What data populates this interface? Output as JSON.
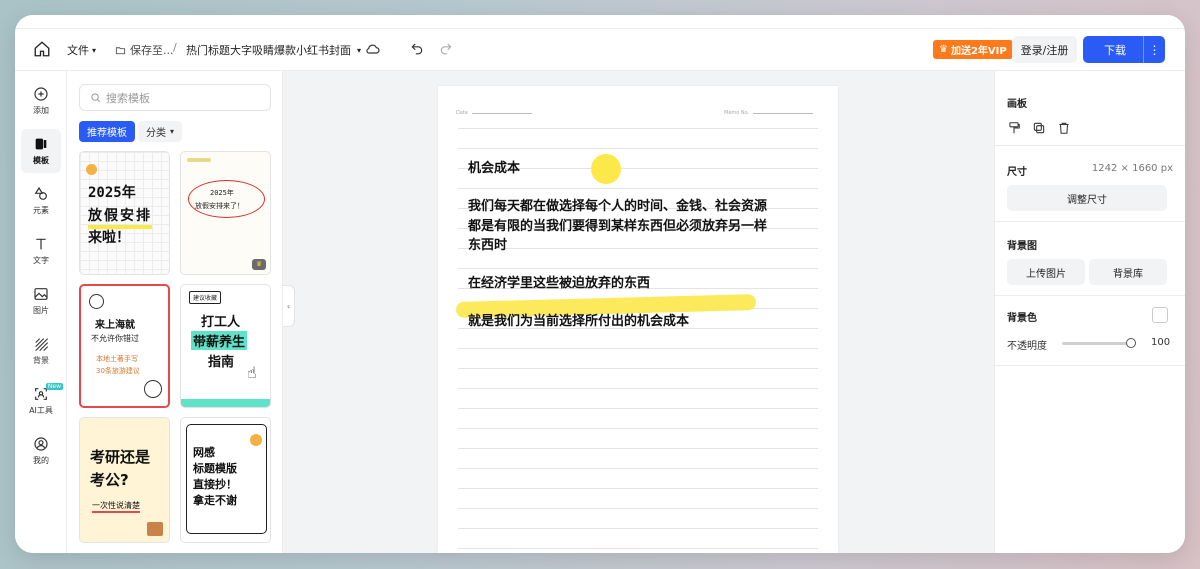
{
  "topbar": {
    "file_label": "文件",
    "save_label": "保存至...",
    "slash": "/",
    "doc_title": "热门标题大字吸睛爆款小红书封面",
    "vip_label": "加送2年VIP",
    "login_label": "登录/注册",
    "download_label": "下载",
    "more_label": "⋮"
  },
  "rail": {
    "items": [
      {
        "label": "添加",
        "icon": "plus-circle-icon"
      },
      {
        "label": "模板",
        "icon": "template-icon"
      },
      {
        "label": "元素",
        "icon": "shapes-icon"
      },
      {
        "label": "文字",
        "icon": "text-icon"
      },
      {
        "label": "图片",
        "icon": "image-icon"
      },
      {
        "label": "背景",
        "icon": "background-icon"
      },
      {
        "label": "AI工具",
        "icon": "ai-scan-icon"
      },
      {
        "label": "我的",
        "icon": "user-icon"
      }
    ],
    "ai_badge": "New"
  },
  "panel": {
    "search_placeholder": "搜索模板",
    "tab_recommended": "推荐模板",
    "tab_category": "分类",
    "cards": {
      "c1": {
        "l1": "2025年",
        "l2": "放假安排",
        "l3": "来啦！"
      },
      "c2": {
        "l1": "2025年",
        "l2": "放假安排来了！"
      },
      "c3": {
        "l1": "来上海就",
        "l2": "不允许你错过",
        "l3": "本地土著手写",
        "l4": "30条旅游建议"
      },
      "c4": {
        "tag": "建议收藏",
        "l1": "打工人",
        "l2": "带薪养生",
        "l3": "指南"
      },
      "c5": {
        "l1": "考研还是",
        "l2": "考公?",
        "l3": "一次性说清楚"
      },
      "c6": {
        "l1": "网感",
        "l2": "标题模版",
        "l3": "直接抄！",
        "l4": "拿走不谢"
      }
    }
  },
  "paper": {
    "date_label": "Date",
    "memo_label": "Memo No.",
    "lines": [
      "机会成本",
      "我们每天都在做选择每个人的时间、金钱、社会资源",
      "都是有限的当我们要得到某样东西但必须放弃另一样",
      "东西时",
      "在经济学里这些被迫放弃的东西",
      "就是我们为当前选择所付出的机会成本"
    ]
  },
  "right": {
    "canvas_title": "画板",
    "size_title": "尺寸",
    "size_value": "1242 × 1660 px",
    "resize_button": "调整尺寸",
    "bg_image_title": "背景图",
    "upload_button": "上传图片",
    "library_button": "背景库",
    "bg_color_title": "背景色",
    "opacity_label": "不透明度",
    "opacity_value": "100"
  },
  "colors": {
    "accent": "#2a5bf5",
    "vip": "#ff7a1a",
    "highlight": "#fde84a"
  }
}
